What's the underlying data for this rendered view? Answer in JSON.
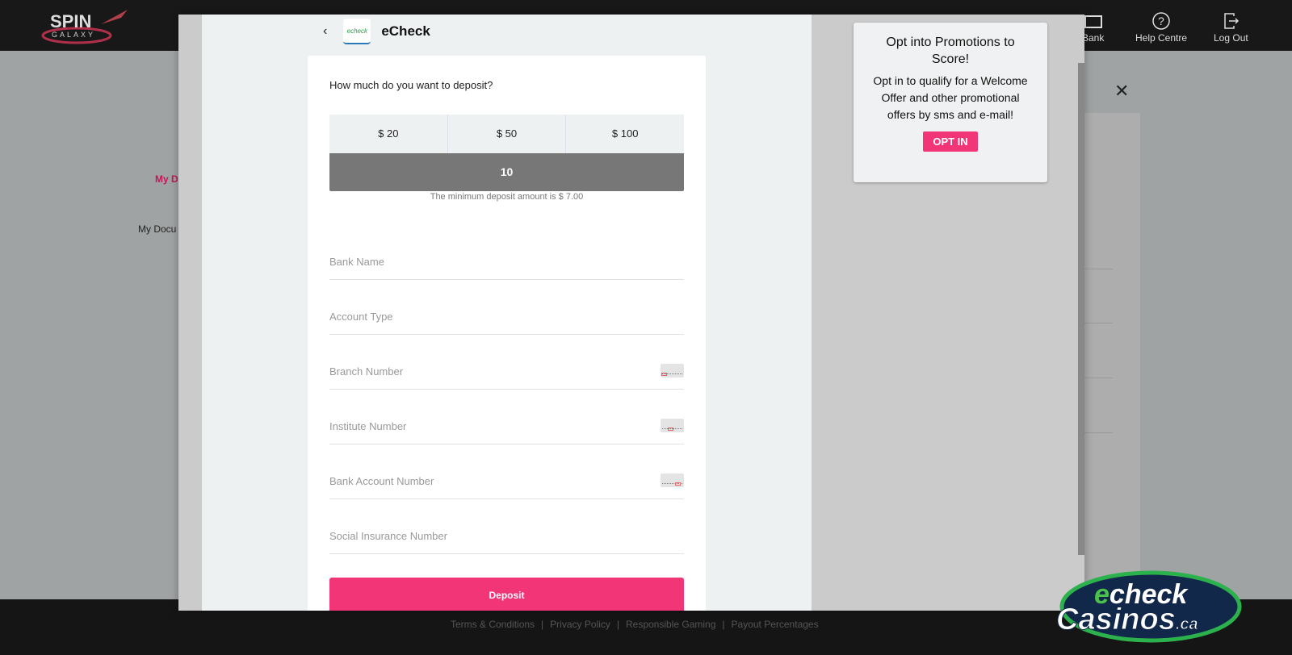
{
  "header": {
    "brand": "SPIN GALAXY",
    "nav": [
      {
        "label": "Bank",
        "icon": "bank-card-icon"
      },
      {
        "label": "Help Centre",
        "icon": "question-circle-icon"
      },
      {
        "label": "Log Out",
        "icon": "logout-icon"
      }
    ]
  },
  "page": {
    "section_title": "My D",
    "documents_link": "My Docu"
  },
  "modal": {
    "title": "eCheck",
    "logo_text": "echeck",
    "question": "How much do you want to deposit?",
    "amounts": [
      "$ 20",
      "$ 50",
      "$ 100"
    ],
    "amount_value": "10",
    "min_note": "The minimum deposit amount is $ 7.00",
    "fields": [
      "Bank Name",
      "Account Type",
      "Branch Number",
      "Institute Number",
      "Bank Account Number",
      "Social Insurance Number"
    ],
    "deposit_label": "Deposit"
  },
  "promo": {
    "title": "Opt into Promotions to Score!",
    "body": "Opt in to qualify for a Welcome Offer and other promotional offers by sms and e-mail!",
    "button": "OPT IN"
  },
  "footer": {
    "links": [
      "Terms & Conditions",
      "Privacy Policy",
      "Responsible Gaming",
      "Payout Percentages"
    ]
  },
  "watermark": "echeck Casinos.ca",
  "colors": {
    "accent": "#f23577",
    "header": "#181818"
  }
}
